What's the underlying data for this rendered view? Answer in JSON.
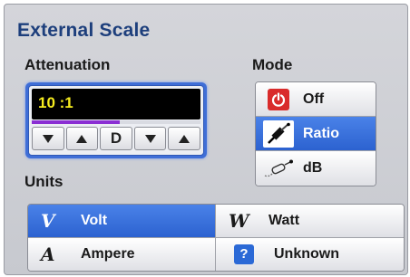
{
  "title": "External Scale",
  "attenuation": {
    "label": "Attenuation",
    "value": "10 :1",
    "bar_fill_fraction": 0.52,
    "bar_color": "#8b2fd3",
    "d_button_label": "D"
  },
  "mode": {
    "label": "Mode",
    "items": [
      {
        "label": "Off",
        "icon": "power-icon",
        "selected": false
      },
      {
        "label": "Ratio",
        "icon": "probe-icon",
        "selected": true
      },
      {
        "label": "dB",
        "icon": "probe-outline-icon",
        "selected": false
      }
    ]
  },
  "units": {
    "label": "Units",
    "items": [
      {
        "label": "Volt",
        "glyph": "V",
        "selected": true
      },
      {
        "label": "Watt",
        "glyph": "W",
        "selected": false
      },
      {
        "label": "Ampere",
        "glyph": "A",
        "selected": false
      },
      {
        "label": "Unknown",
        "glyph": "?",
        "selected": false
      }
    ]
  },
  "colors": {
    "accent": "#2c62d0",
    "title": "#1d3f7c",
    "display_text": "#f6ec1f",
    "off_icon": "#d92b2b"
  }
}
